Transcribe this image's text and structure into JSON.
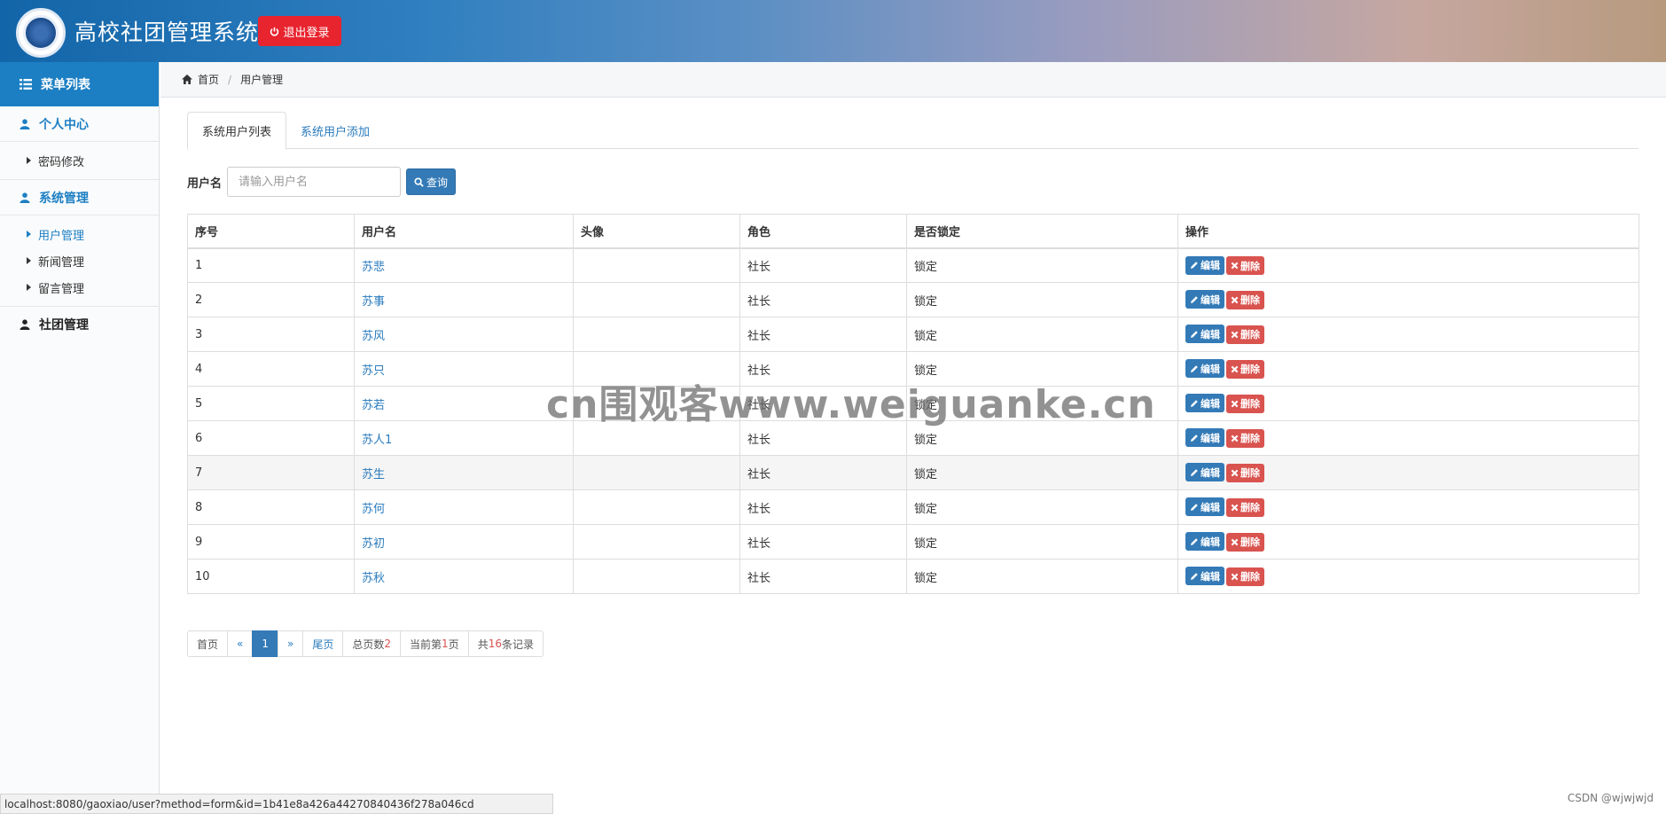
{
  "header": {
    "title": "高校社团管理系统",
    "logout_label": "退出登录"
  },
  "sidebar": {
    "menu_title": "菜单列表",
    "groups": [
      {
        "label": "个人中心",
        "items": [
          {
            "label": "密码修改"
          }
        ]
      },
      {
        "label": "系统管理",
        "items": [
          {
            "label": "用户管理"
          },
          {
            "label": "新闻管理"
          },
          {
            "label": "留言管理"
          }
        ]
      },
      {
        "label": "社团管理",
        "items": []
      }
    ]
  },
  "breadcrumb": {
    "home": "首页",
    "current": "用户管理"
  },
  "tabs": [
    {
      "label": "系统用户列表"
    },
    {
      "label": "系统用户添加"
    }
  ],
  "search": {
    "label": "用户名",
    "placeholder": "请输入用户名",
    "button": "查询"
  },
  "table": {
    "columns": [
      "序号",
      "用户名",
      "头像",
      "角色",
      "是否锁定",
      "操作"
    ],
    "edit_label": "编辑",
    "delete_label": "删除",
    "rows": [
      {
        "no": "1",
        "name": "苏悲",
        "avatar": "",
        "role": "社长",
        "locked": "锁定"
      },
      {
        "no": "2",
        "name": "苏事",
        "avatar": "",
        "role": "社长",
        "locked": "锁定"
      },
      {
        "no": "3",
        "name": "苏风",
        "avatar": "",
        "role": "社长",
        "locked": "锁定"
      },
      {
        "no": "4",
        "name": "苏只",
        "avatar": "",
        "role": "社长",
        "locked": "锁定"
      },
      {
        "no": "5",
        "name": "苏若",
        "avatar": "",
        "role": "社长",
        "locked": "锁定"
      },
      {
        "no": "6",
        "name": "苏人1",
        "avatar": "",
        "role": "社长",
        "locked": "锁定"
      },
      {
        "no": "7",
        "name": "苏生",
        "avatar": "",
        "role": "社长",
        "locked": "锁定"
      },
      {
        "no": "8",
        "name": "苏何",
        "avatar": "",
        "role": "社长",
        "locked": "锁定"
      },
      {
        "no": "9",
        "name": "苏初",
        "avatar": "",
        "role": "社长",
        "locked": "锁定"
      },
      {
        "no": "10",
        "name": "苏秋",
        "avatar": "",
        "role": "社长",
        "locked": "锁定"
      }
    ]
  },
  "pagination": {
    "first": "首页",
    "prev": "«",
    "current": "1",
    "next": "»",
    "last": "尾页",
    "total_pages_prefix": "总页数",
    "total_pages": "2",
    "current_page_prefix": "当前第",
    "current_page": "1",
    "current_page_suffix": "页",
    "total_records_prefix": "共",
    "total_records": "16",
    "total_records_suffix": "条记录"
  },
  "watermark": "cn围观客www.weiguanke.cn",
  "statusbar": {
    "url": "localhost:8080/gaoxiao/user?method=form&id=1b41e8a426a44270840436f278a046cd"
  },
  "footer_credit": "CSDN @wjwjwjd",
  "colors": {
    "primary": "#337ab7",
    "danger": "#d9534f",
    "logout": "#e8242f",
    "sidebar_active": "#1c7fc3"
  }
}
